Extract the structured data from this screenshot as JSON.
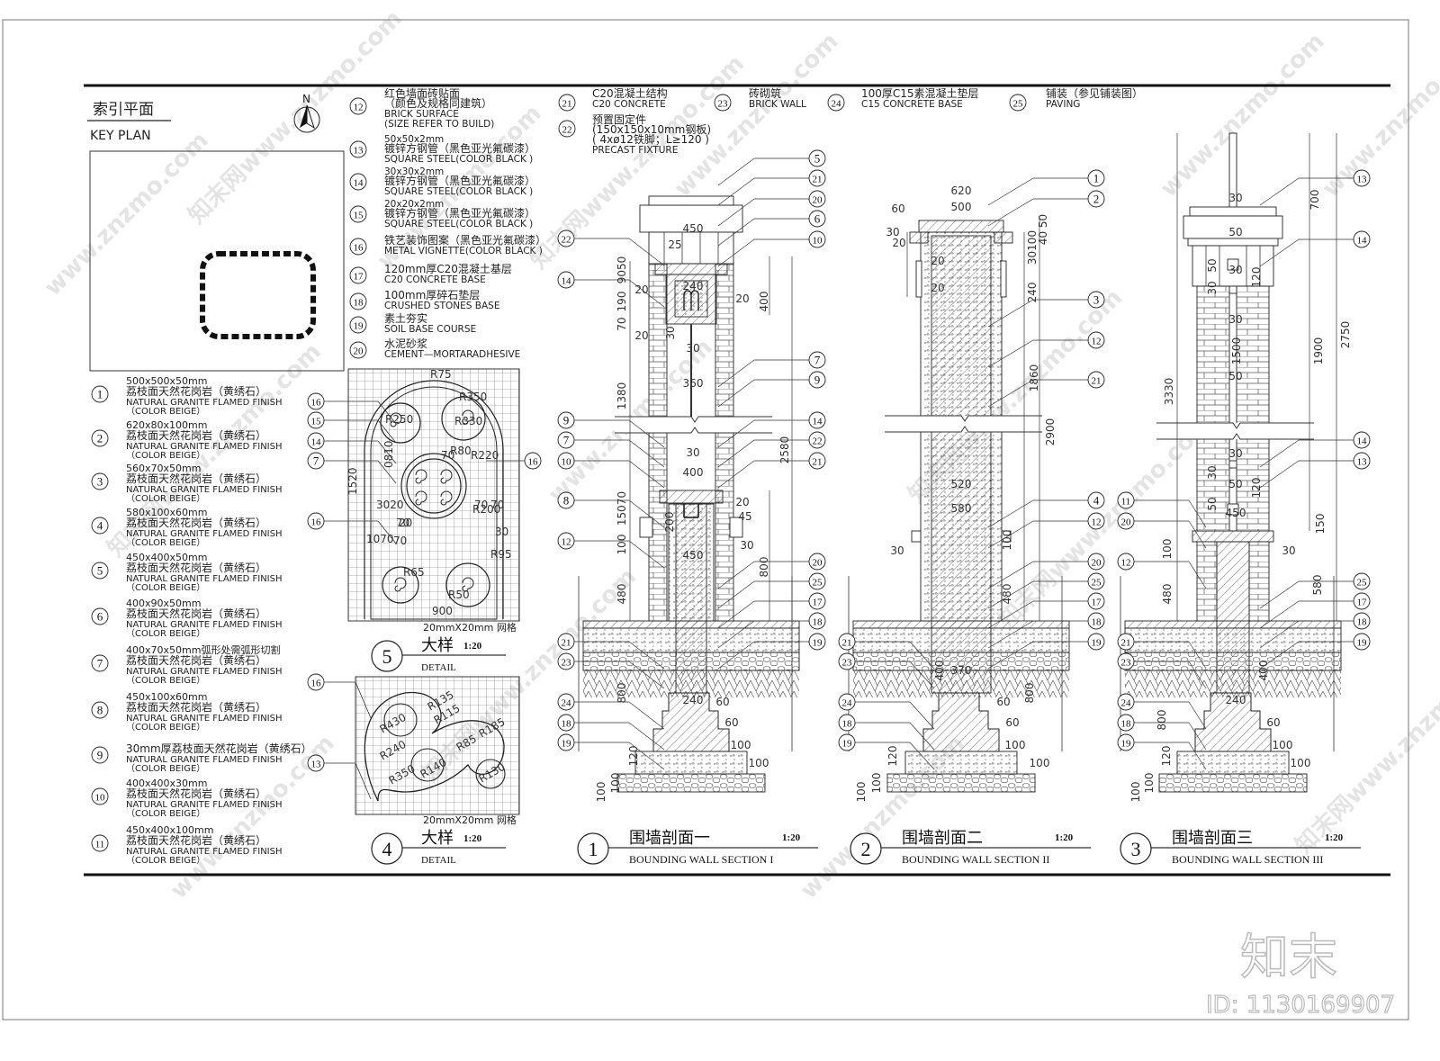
{
  "key_plan": {
    "title_cn": "索引平面",
    "title_en": "KEY PLAN",
    "north": "N"
  },
  "legend_left": [
    {
      "num": "1",
      "size": "500x500x50mm",
      "cn": "荔枝面天然花岗岩（黄绣石）",
      "en": "NATURAL GRANITE FLAMED FINISH",
      "color": "（COLOR BEIGE）"
    },
    {
      "num": "2",
      "size": "620x80x100mm",
      "cn": "荔枝面天然花岗岩（黄绣石）",
      "en": "NATURAL GRANITE FLAMED FINISH",
      "color": "（COLOR BEIGE）"
    },
    {
      "num": "3",
      "size": "560x70x50mm",
      "cn": "荔枝面天然花岗岩（黄绣石）",
      "en": "NATURAL GRANITE FLAMED FINISH",
      "color": "（COLOR BEIGE）"
    },
    {
      "num": "4",
      "size": "580x100x60mm",
      "cn": "荔枝面天然花岗岩（黄绣石）",
      "en": "NATURAL GRANITE FLAMED FINISH",
      "color": "（COLOR BEIGE）"
    },
    {
      "num": "5",
      "size": "450x400x50mm",
      "cn": "荔枝面天然花岗岩（黄绣石）",
      "en": "NATURAL GRANITE FLAMED FINISH",
      "color": "（COLOR BEIGE）"
    },
    {
      "num": "6",
      "size": "400x90x50mm",
      "cn": "荔枝面天然花岗岩（黄绣石）",
      "en": "NATURAL GRANITE FLAMED FINISH",
      "color": "（COLOR BEIGE）"
    },
    {
      "num": "7",
      "size": "400x70x50mm弧形处需弧形切割",
      "cn": "荔枝面天然花岗岩（黄绣石）",
      "en": "NATURAL GRANITE FLAMED FINISH",
      "color": "（COLOR BEIGE）"
    },
    {
      "num": "8",
      "size": "450x100x60mm",
      "cn": "荔枝面天然花岗岩（黄绣石）",
      "en": "NATURAL GRANITE FLAMED FINISH",
      "color": "（COLOR BEIGE）"
    },
    {
      "num": "9",
      "size": "",
      "cn": "30mm厚荔枝面天然花岗岩（黄绣石）",
      "en": "NATURAL GRANITE FLAMED FINISH",
      "color": "（COLOR BEIGE）"
    },
    {
      "num": "10",
      "size": "400x400x30mm",
      "cn": "荔枝面天然花岗岩（黄绣石）",
      "en": "NATURAL GRANITE FLAMED FINISH",
      "color": "（COLOR BEIGE）"
    },
    {
      "num": "11",
      "size": "450x400x100mm",
      "cn": "荔枝面天然花岗岩（黄绣石）",
      "en": "NATURAL GRANITE FLAMED FINISH",
      "color": "（COLOR BEIGE）"
    }
  ],
  "legend_mid": [
    {
      "num": "12",
      "lines": [
        "红色墙面砖贴面",
        "（颜色及规格同建筑）",
        "BRICK SURFACE",
        "(SIZE REFER TO BUILD)"
      ]
    },
    {
      "num": "13",
      "lines": [
        "50x50x2mm",
        "镀锌方钢管（黑色亚光氟碳漆）",
        "SQUARE STEEL(COLOR BLACK )"
      ]
    },
    {
      "num": "14",
      "lines": [
        "30x30x2mm",
        "镀锌方钢管（黑色亚光氟碳漆）",
        "SQUARE STEEL(COLOR BLACK )"
      ]
    },
    {
      "num": "15",
      "lines": [
        "20x20x2mm",
        "镀锌方钢管（黑色亚光氟碳漆）",
        "SQUARE STEEL(COLOR BLACK )"
      ]
    },
    {
      "num": "16",
      "lines": [
        "铁艺装饰图案（黑色亚光氟碳漆）",
        "METAL VIGNETTE(COLOR BLACK )"
      ]
    },
    {
      "num": "17",
      "lines": [
        "120mm厚C20混凝土基层",
        "C20 CONCRETE BASE"
      ]
    },
    {
      "num": "18",
      "lines": [
        "100mm厚碎石垫层",
        "CRUSHED STONES BASE"
      ]
    },
    {
      "num": "19",
      "lines": [
        "素土夯实",
        "SOIL BASE COURSE"
      ]
    },
    {
      "num": "20",
      "lines": [
        "水泥砂浆",
        "CEMENT—MORTARADHESIVE"
      ]
    }
  ],
  "legend_top": [
    {
      "num": "21",
      "lines": [
        "C20混凝土结构",
        "C20 CONCRETE"
      ]
    },
    {
      "num": "22",
      "lines": [
        "预置固定件",
        "(150x150x10mm钢板)",
        "( 4xø12铁脚；L≥120 )",
        "PRECAST FIXTURE"
      ]
    },
    {
      "num": "23",
      "lines": [
        "砖砌筑",
        "BRICK WALL"
      ]
    },
    {
      "num": "24",
      "lines": [
        "100厚C15素混凝土垫层",
        "C15 CONCRETE BASE"
      ]
    },
    {
      "num": "25",
      "lines": [
        "铺装（参见铺装图）",
        "PAVING"
      ]
    }
  ],
  "details": [
    {
      "num": "5",
      "title": "大样",
      "scale": "1:20",
      "en": "DETAIL",
      "grid": "20mmX20mm 网格",
      "callouts_left": [
        "16",
        "15",
        "14",
        "7",
        "16"
      ],
      "callouts_right": [
        "16"
      ],
      "dims": [
        "R75",
        "R250",
        "R330",
        "R350",
        "0810",
        "70",
        "R220",
        "R80",
        "1520",
        "3020",
        "70",
        "70",
        "70",
        "20",
        "1070",
        "70",
        "30",
        "R95",
        "R200",
        "R65",
        "R50",
        "900"
      ]
    },
    {
      "num": "4",
      "title": "大样",
      "scale": "1:20",
      "en": "DETAIL",
      "grid": "20mmX20mm 网格",
      "callouts_left": [
        "16",
        "13"
      ],
      "dims": [
        "R135",
        "R430",
        "R115",
        "R85",
        "R185",
        "R240",
        "R350",
        "R140",
        "R130"
      ]
    }
  ],
  "sections": [
    {
      "num": "1",
      "title_cn": "围墙剖面一",
      "title_en": "BOUNDING WALL SECTION I",
      "scale": "1:20",
      "callouts_left": [
        "22",
        "14",
        "9",
        "7",
        "10",
        "8",
        "12",
        "21",
        "23",
        "24",
        "18",
        "19"
      ],
      "callouts_right": [
        "5",
        "21",
        "20",
        "6",
        "10",
        "7",
        "9",
        "14",
        "22",
        "21",
        "20",
        "25",
        "17",
        "18",
        "19"
      ],
      "dims": [
        "450",
        "25",
        "240",
        "20",
        "20",
        "400",
        "30",
        "30",
        "360",
        "1380",
        "2580",
        "30",
        "400",
        "200",
        "20",
        "45",
        "450",
        "30",
        "800",
        "480",
        "800",
        "240",
        "60",
        "60",
        "100",
        "100",
        "120",
        "100",
        "100",
        "9050",
        "190",
        "70",
        "20",
        "15070",
        "100"
      ]
    },
    {
      "num": "2",
      "title_cn": "围墙剖面二",
      "title_en": "BOUNDING WALL SECTION II",
      "scale": "1:20",
      "callouts_left": [
        "21",
        "23",
        "24",
        "18",
        "19"
      ],
      "callouts_right": [
        "1",
        "2",
        "3",
        "12",
        "21",
        "4",
        "12",
        "20",
        "25",
        "17",
        "18",
        "19"
      ],
      "dims": [
        "620",
        "500",
        "60",
        "30",
        "20",
        "20",
        "20",
        "1860",
        "2900",
        "240",
        "30100",
        "40 50",
        "520",
        "580",
        "30",
        "100",
        "480",
        "370",
        "400",
        "60",
        "60",
        "100",
        "100",
        "800",
        "120",
        "100",
        "100"
      ]
    },
    {
      "num": "3",
      "title_cn": "围墙剖面三",
      "title_en": "BOUNDING WALL SECTION III",
      "scale": "1:20",
      "callouts_left": [
        "11",
        "20",
        "12",
        "21",
        "23",
        "24",
        "18",
        "19"
      ],
      "callouts_right": [
        "13",
        "14",
        "14",
        "13",
        "25",
        "17",
        "18",
        "19"
      ],
      "dims": [
        "3330",
        "700",
        "2750",
        "1900",
        "1500",
        "30",
        "50",
        "50",
        "30",
        "120",
        "30",
        "30",
        "50",
        "30",
        "30",
        "50",
        "120",
        "50",
        "450",
        "150",
        "100",
        "30",
        "480",
        "580",
        "400",
        "240",
        "60",
        "100",
        "100",
        "800",
        "120",
        "100",
        "100"
      ]
    }
  ],
  "watermark": {
    "site": "www.znzmo.com",
    "brand": "知末网",
    "logo": "知末",
    "id": "ID: 1130169907"
  },
  "colors": {
    "line": "#222222",
    "watermark": "#e4e4e4"
  }
}
